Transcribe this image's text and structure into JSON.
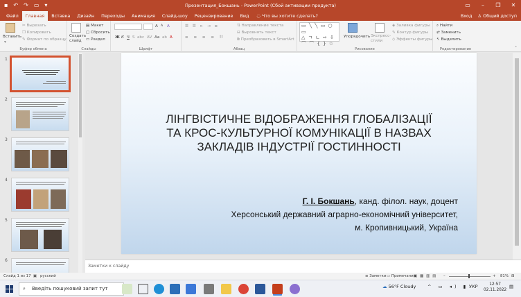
{
  "window": {
    "title": "Презентация_Бокшань - PowerPoint (Сбой активации продукта)"
  },
  "tabs": [
    "Файл",
    "Главная",
    "Вставка",
    "Дизайн",
    "Переходы",
    "Анимация",
    "Слайд-шоу",
    "Рецензирование",
    "Вид"
  ],
  "tell_me": "Что вы хотите сделать?",
  "account": {
    "login": "Вход",
    "share": "Общий доступ"
  },
  "ribbon": {
    "clipboard": {
      "paste": "Вставить",
      "cut": "Вырезать",
      "copy": "Копировать",
      "format_painter": "Формат по образцу",
      "label": "Буфер обмена"
    },
    "slides": {
      "new_slide": "Создать слайд",
      "layout": "Макет",
      "reset": "Сбросить",
      "section": "Раздел",
      "label": "Слайды"
    },
    "font": {
      "label": "Шрифт",
      "bold": "Ж",
      "italic": "К",
      "underline": "Ч",
      "strike": "S",
      "shadow": "abc",
      "spacing": "AV",
      "case": "Aa",
      "font_color": "A"
    },
    "paragraph": {
      "text_direction": "Направление текста",
      "align_text": "Выровнять текст",
      "smartart": "Преобразовать в SmartArt",
      "label": "Абзац"
    },
    "drawing": {
      "arrange": "Упорядочить",
      "quick_styles": "Экспресс-стили",
      "fill": "Заливка фигуры",
      "outline": "Контур фигуры",
      "effects": "Эффекты фигуры",
      "label": "Рисование"
    },
    "editing": {
      "find": "Найти",
      "replace": "Заменить",
      "select": "Выделить",
      "label": "Редактирование"
    }
  },
  "thumbnails": [
    {
      "num": "1",
      "selected": true
    },
    {
      "num": "2",
      "selected": false
    },
    {
      "num": "3",
      "selected": false
    },
    {
      "num": "4",
      "selected": false
    },
    {
      "num": "5",
      "selected": false
    },
    {
      "num": "6",
      "selected": false
    }
  ],
  "slide": {
    "title_lines": [
      "ЛІНГВІСТИЧНЕ ВІДОБРАЖЕННЯ ГЛОБАЛІЗАЦІЇ",
      "ТА КРОС-КУЛЬТУРНОЇ КОМУНІКАЦІЇ В НАЗВАХ",
      "ЗАКЛАДІВ ІНДУСТРІЇ ГОСТИННОСТІ"
    ],
    "author_name": "Г. І. Бокшань",
    "author_degree": ", канд. філол. наук, доцент",
    "affiliation": "Херсонський державний аграрно-економічний університет,",
    "city": "м. Кропивницький, Україна"
  },
  "notes_placeholder": "Заметки к слайду",
  "status": {
    "slide": "Слайд 1 из 17",
    "lang": "русский",
    "notes": "Заметки",
    "comments": "Примечания",
    "zoom": "81%"
  },
  "taskbar": {
    "search": "Введіть пошуковий запит тут",
    "weather": "56°F  Cloudy",
    "lang": "УКР",
    "time": "12:57",
    "date": "02.11.2022"
  }
}
